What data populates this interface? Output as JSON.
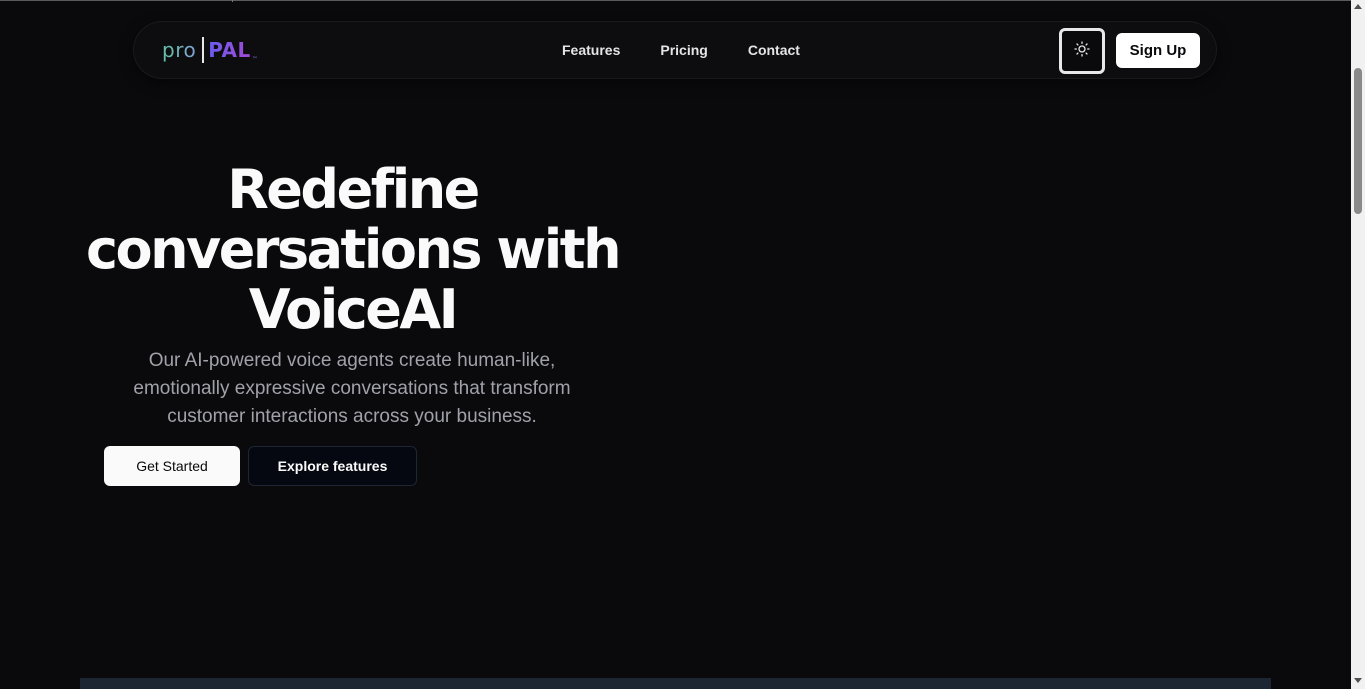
{
  "brand": {
    "logo_pro": "pro",
    "logo_pal": "PAL",
    "logo_tm": "™"
  },
  "nav": {
    "links": [
      "Features",
      "Pricing",
      "Contact"
    ],
    "signup_label": "Sign Up",
    "theme_toggle_icon": "sun-icon"
  },
  "hero": {
    "title": "Redefine conversations with VoiceAI",
    "subtitle": "Our AI-powered voice agents create human-like, emotionally expressive conversations that transform customer interactions across your business.",
    "primary_button": "Get Started",
    "secondary_button": "Explore features"
  },
  "colors": {
    "background": "#0a0a0c",
    "logo_pro": "#62c3a6",
    "logo_pal": "#7a4fd8"
  }
}
